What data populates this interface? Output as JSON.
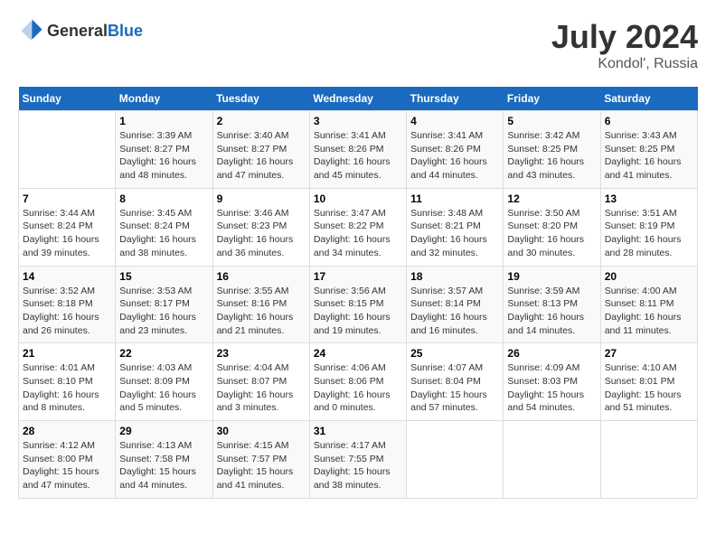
{
  "header": {
    "logo_general": "General",
    "logo_blue": "Blue",
    "title": "July 2024",
    "location": "Kondol', Russia"
  },
  "days_of_week": [
    "Sunday",
    "Monday",
    "Tuesday",
    "Wednesday",
    "Thursday",
    "Friday",
    "Saturday"
  ],
  "weeks": [
    [
      {
        "day": "",
        "info": ""
      },
      {
        "day": "1",
        "info": "Sunrise: 3:39 AM\nSunset: 8:27 PM\nDaylight: 16 hours\nand 48 minutes."
      },
      {
        "day": "2",
        "info": "Sunrise: 3:40 AM\nSunset: 8:27 PM\nDaylight: 16 hours\nand 47 minutes."
      },
      {
        "day": "3",
        "info": "Sunrise: 3:41 AM\nSunset: 8:26 PM\nDaylight: 16 hours\nand 45 minutes."
      },
      {
        "day": "4",
        "info": "Sunrise: 3:41 AM\nSunset: 8:26 PM\nDaylight: 16 hours\nand 44 minutes."
      },
      {
        "day": "5",
        "info": "Sunrise: 3:42 AM\nSunset: 8:25 PM\nDaylight: 16 hours\nand 43 minutes."
      },
      {
        "day": "6",
        "info": "Sunrise: 3:43 AM\nSunset: 8:25 PM\nDaylight: 16 hours\nand 41 minutes."
      }
    ],
    [
      {
        "day": "7",
        "info": "Sunrise: 3:44 AM\nSunset: 8:24 PM\nDaylight: 16 hours\nand 39 minutes."
      },
      {
        "day": "8",
        "info": "Sunrise: 3:45 AM\nSunset: 8:24 PM\nDaylight: 16 hours\nand 38 minutes."
      },
      {
        "day": "9",
        "info": "Sunrise: 3:46 AM\nSunset: 8:23 PM\nDaylight: 16 hours\nand 36 minutes."
      },
      {
        "day": "10",
        "info": "Sunrise: 3:47 AM\nSunset: 8:22 PM\nDaylight: 16 hours\nand 34 minutes."
      },
      {
        "day": "11",
        "info": "Sunrise: 3:48 AM\nSunset: 8:21 PM\nDaylight: 16 hours\nand 32 minutes."
      },
      {
        "day": "12",
        "info": "Sunrise: 3:50 AM\nSunset: 8:20 PM\nDaylight: 16 hours\nand 30 minutes."
      },
      {
        "day": "13",
        "info": "Sunrise: 3:51 AM\nSunset: 8:19 PM\nDaylight: 16 hours\nand 28 minutes."
      }
    ],
    [
      {
        "day": "14",
        "info": "Sunrise: 3:52 AM\nSunset: 8:18 PM\nDaylight: 16 hours\nand 26 minutes."
      },
      {
        "day": "15",
        "info": "Sunrise: 3:53 AM\nSunset: 8:17 PM\nDaylight: 16 hours\nand 23 minutes."
      },
      {
        "day": "16",
        "info": "Sunrise: 3:55 AM\nSunset: 8:16 PM\nDaylight: 16 hours\nand 21 minutes."
      },
      {
        "day": "17",
        "info": "Sunrise: 3:56 AM\nSunset: 8:15 PM\nDaylight: 16 hours\nand 19 minutes."
      },
      {
        "day": "18",
        "info": "Sunrise: 3:57 AM\nSunset: 8:14 PM\nDaylight: 16 hours\nand 16 minutes."
      },
      {
        "day": "19",
        "info": "Sunrise: 3:59 AM\nSunset: 8:13 PM\nDaylight: 16 hours\nand 14 minutes."
      },
      {
        "day": "20",
        "info": "Sunrise: 4:00 AM\nSunset: 8:11 PM\nDaylight: 16 hours\nand 11 minutes."
      }
    ],
    [
      {
        "day": "21",
        "info": "Sunrise: 4:01 AM\nSunset: 8:10 PM\nDaylight: 16 hours\nand 8 minutes."
      },
      {
        "day": "22",
        "info": "Sunrise: 4:03 AM\nSunset: 8:09 PM\nDaylight: 16 hours\nand 5 minutes."
      },
      {
        "day": "23",
        "info": "Sunrise: 4:04 AM\nSunset: 8:07 PM\nDaylight: 16 hours\nand 3 minutes."
      },
      {
        "day": "24",
        "info": "Sunrise: 4:06 AM\nSunset: 8:06 PM\nDaylight: 16 hours\nand 0 minutes."
      },
      {
        "day": "25",
        "info": "Sunrise: 4:07 AM\nSunset: 8:04 PM\nDaylight: 15 hours\nand 57 minutes."
      },
      {
        "day": "26",
        "info": "Sunrise: 4:09 AM\nSunset: 8:03 PM\nDaylight: 15 hours\nand 54 minutes."
      },
      {
        "day": "27",
        "info": "Sunrise: 4:10 AM\nSunset: 8:01 PM\nDaylight: 15 hours\nand 51 minutes."
      }
    ],
    [
      {
        "day": "28",
        "info": "Sunrise: 4:12 AM\nSunset: 8:00 PM\nDaylight: 15 hours\nand 47 minutes."
      },
      {
        "day": "29",
        "info": "Sunrise: 4:13 AM\nSunset: 7:58 PM\nDaylight: 15 hours\nand 44 minutes."
      },
      {
        "day": "30",
        "info": "Sunrise: 4:15 AM\nSunset: 7:57 PM\nDaylight: 15 hours\nand 41 minutes."
      },
      {
        "day": "31",
        "info": "Sunrise: 4:17 AM\nSunset: 7:55 PM\nDaylight: 15 hours\nand 38 minutes."
      },
      {
        "day": "",
        "info": ""
      },
      {
        "day": "",
        "info": ""
      },
      {
        "day": "",
        "info": ""
      }
    ]
  ]
}
